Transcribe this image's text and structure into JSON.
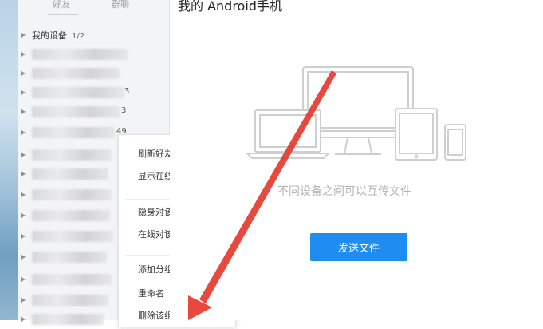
{
  "sidebar": {
    "tabs": [
      {
        "label": "好友"
      },
      {
        "label": "群聊"
      }
    ],
    "my_device_group": {
      "title": "我的设备",
      "count": "1/2"
    },
    "blurred_suffixes": [
      "3",
      "3",
      "49"
    ]
  },
  "context_menu": {
    "items": [
      {
        "label": "刷新好友列表"
      },
      {
        "label": "显示在线联系人"
      },
      {
        "label": "隐身对该分组可见"
      },
      {
        "label": "在线对该分组隐身"
      },
      {
        "label": "添加分组"
      },
      {
        "label": "重命名"
      },
      {
        "label": "删除该组"
      }
    ]
  },
  "main": {
    "title": "我的 Android手机",
    "tagline": "不同设备之间可以互传文件",
    "send_button_label": "发送文件"
  },
  "colors": {
    "accent": "#1e8cf0",
    "annotation_arrow": "#e63a2e"
  }
}
